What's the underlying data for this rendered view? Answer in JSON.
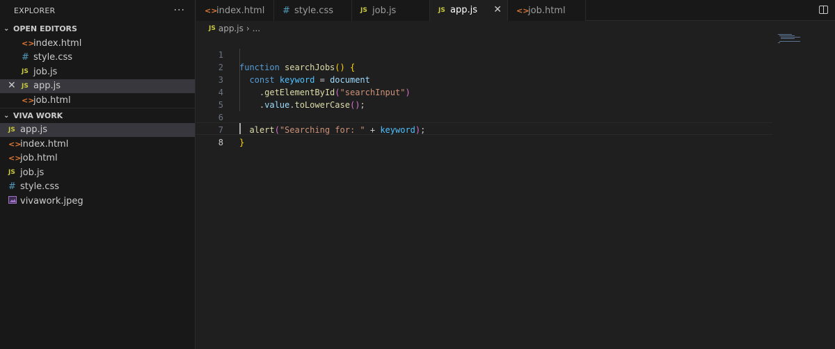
{
  "explorer": {
    "title": "EXPLORER",
    "more": "···",
    "open_editors_title": "OPEN EDITORS",
    "open_editors": [
      {
        "icon": "html",
        "name": "index.html"
      },
      {
        "icon": "css",
        "name": "style.css"
      },
      {
        "icon": "js",
        "name": "job.js"
      },
      {
        "icon": "js",
        "name": "app.js",
        "active": true
      },
      {
        "icon": "html",
        "name": "job.html"
      }
    ],
    "workspace_title": "VIVA WORK",
    "files": [
      {
        "icon": "js",
        "name": "app.js",
        "active": true
      },
      {
        "icon": "html",
        "name": "index.html"
      },
      {
        "icon": "html",
        "name": "job.html"
      },
      {
        "icon": "js",
        "name": "job.js"
      },
      {
        "icon": "css",
        "name": "style.css"
      },
      {
        "icon": "image",
        "name": "vivawork.jpeg"
      }
    ]
  },
  "icons": {
    "html": "<>",
    "css": "#",
    "js": "JS",
    "close": "✕",
    "chevron": "⌄"
  },
  "tabs": [
    {
      "icon": "html",
      "label": "index.html"
    },
    {
      "icon": "css",
      "label": "style.css"
    },
    {
      "icon": "js",
      "label": "job.js"
    },
    {
      "icon": "js",
      "label": "app.js",
      "active": true
    },
    {
      "icon": "html",
      "label": "job.html"
    }
  ],
  "breadcrumb": {
    "file": "app.js",
    "rest": "..."
  },
  "editor": {
    "line_numbers": [
      "1",
      "2",
      "3",
      "4",
      "5",
      "6",
      "7",
      "8"
    ],
    "current_line": "8",
    "lines": [
      "function searchJobs() {",
      "  const keyword = document",
      "    .getElementById(\"searchInput\")",
      "    .value.toLowerCase();",
      "",
      "  alert(\"Searching for: \" + keyword);",
      "}",
      ""
    ]
  },
  "colors": {
    "keyword": "#569cd6",
    "function": "#dcdcaa",
    "string": "#ce9178",
    "variable": "#9cdcfe",
    "bracket": "#ffd700",
    "js_icon": "#cbcb41",
    "html_icon": "#e37933",
    "css_icon": "#519aba"
  }
}
